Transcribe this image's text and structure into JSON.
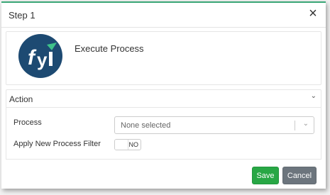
{
  "dialog": {
    "title": "Step 1",
    "close_icon": "close-icon",
    "accent_color": "#3aa776"
  },
  "step": {
    "logo_icon": "fyi-logo",
    "name": "Execute Process"
  },
  "action": {
    "section_label": "Action",
    "chevron_icon": "chevron-down-icon",
    "process_label": "Process",
    "process_placeholder": "None selected",
    "filter_label": "Apply New Process Filter",
    "filter_toggle_value": "NO"
  },
  "footer": {
    "save_label": "Save",
    "cancel_label": "Cancel",
    "save_color": "#28a745",
    "cancel_color": "#6c757d"
  }
}
